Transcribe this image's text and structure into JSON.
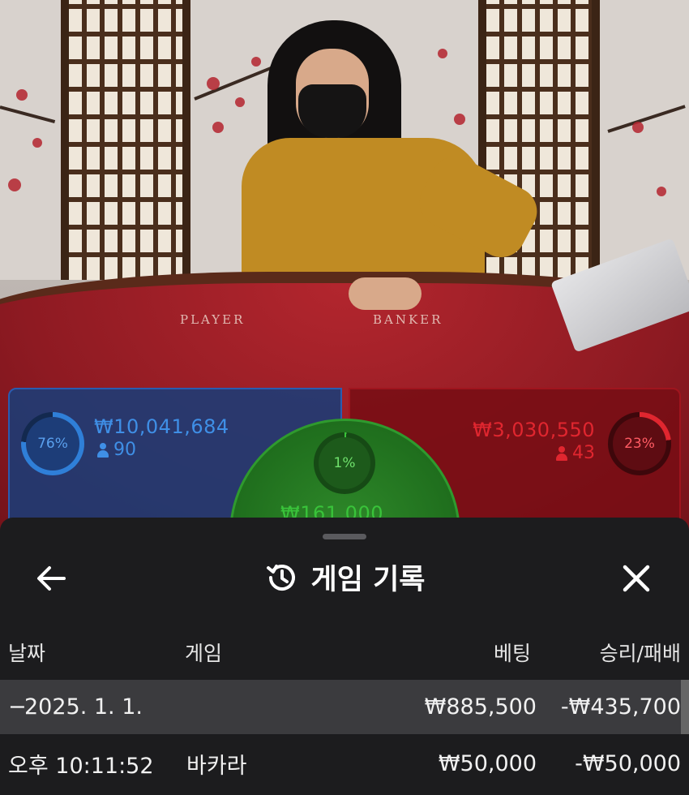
{
  "table": {
    "player_label": "PLAYER",
    "banker_label": "BANKER"
  },
  "bets": {
    "player": {
      "percent_label": "76%",
      "percent": 76,
      "amount": "₩10,041,684",
      "players": "90",
      "color": "#2f7fd8"
    },
    "tie": {
      "percent_label": "1%",
      "percent": 1,
      "amount": "₩161,000",
      "color": "#39c33a"
    },
    "banker": {
      "percent_label": "23%",
      "percent": 23,
      "amount": "₩3,030,550",
      "players": "43",
      "color": "#e0262f"
    }
  },
  "sheet": {
    "title": "게임 기록",
    "back_icon": "arrow-left-icon",
    "history_icon": "history-icon",
    "close_icon": "close-icon",
    "columns": {
      "date": "날짜",
      "game": "게임",
      "bet": "베팅",
      "result": "승리/패배"
    },
    "date_row": {
      "toggle": "−",
      "date": "2025. 1. 1.",
      "bet_total": "₩885,500",
      "result_total": "-₩435,700"
    },
    "rows": [
      {
        "time": "오후 10:11:52",
        "game": "바카라",
        "bet": "₩50,000",
        "result": "-₩50,000"
      }
    ]
  },
  "colors": {
    "sheet_bg": "#1c1c1e",
    "date_row_bg": "#3b3b3e",
    "text": "#f1f1f1"
  }
}
